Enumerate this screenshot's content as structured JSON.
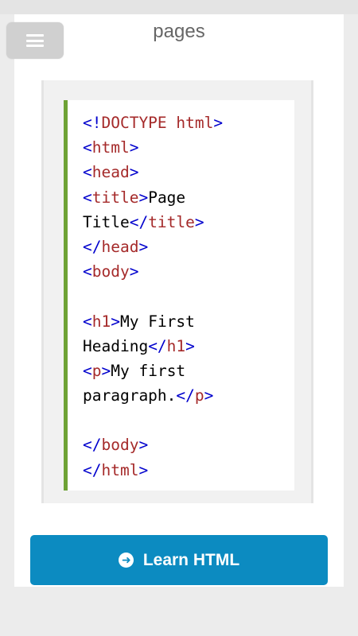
{
  "header": {
    "menu_icon": "hamburger-menu-icon",
    "title": "pages"
  },
  "colors": {
    "accent_border": "#6ea235",
    "button_bg": "#0c8bc1",
    "tag_bracket": "#0000cd",
    "tag_name": "#a52a2a"
  },
  "code_example": {
    "lines": [
      [
        {
          "t": "<!",
          "c": "b"
        },
        {
          "t": "DOCTYPE html",
          "c": "n"
        },
        {
          "t": ">",
          "c": "b"
        }
      ],
      [
        {
          "t": "<",
          "c": "b"
        },
        {
          "t": "html",
          "c": "n"
        },
        {
          "t": ">",
          "c": "b"
        }
      ],
      [
        {
          "t": "<",
          "c": "b"
        },
        {
          "t": "head",
          "c": "n"
        },
        {
          "t": ">",
          "c": "b"
        }
      ],
      [
        {
          "t": "<",
          "c": "b"
        },
        {
          "t": "title",
          "c": "n"
        },
        {
          "t": ">",
          "c": "b"
        },
        {
          "t": "Page",
          "c": "x"
        }
      ],
      [
        {
          "t": "Title",
          "c": "x"
        },
        {
          "t": "</",
          "c": "b"
        },
        {
          "t": "title",
          "c": "n"
        },
        {
          "t": ">",
          "c": "b"
        }
      ],
      [
        {
          "t": "</",
          "c": "b"
        },
        {
          "t": "head",
          "c": "n"
        },
        {
          "t": ">",
          "c": "b"
        }
      ],
      [
        {
          "t": "<",
          "c": "b"
        },
        {
          "t": "body",
          "c": "n"
        },
        {
          "t": ">",
          "c": "b"
        }
      ],
      [],
      [
        {
          "t": "<",
          "c": "b"
        },
        {
          "t": "h1",
          "c": "n"
        },
        {
          "t": ">",
          "c": "b"
        },
        {
          "t": "My First",
          "c": "x"
        }
      ],
      [
        {
          "t": "Heading",
          "c": "x"
        },
        {
          "t": "</",
          "c": "b"
        },
        {
          "t": "h1",
          "c": "n"
        },
        {
          "t": ">",
          "c": "b"
        }
      ],
      [
        {
          "t": "<",
          "c": "b"
        },
        {
          "t": "p",
          "c": "n"
        },
        {
          "t": ">",
          "c": "b"
        },
        {
          "t": "My first",
          "c": "x"
        }
      ],
      [
        {
          "t": "paragraph.",
          "c": "x"
        },
        {
          "t": "</",
          "c": "b"
        },
        {
          "t": "p",
          "c": "n"
        },
        {
          "t": ">",
          "c": "b"
        }
      ],
      [],
      [
        {
          "t": "</",
          "c": "b"
        },
        {
          "t": "body",
          "c": "n"
        },
        {
          "t": ">",
          "c": "b"
        }
      ],
      [
        {
          "t": "</",
          "c": "b"
        },
        {
          "t": "html",
          "c": "n"
        },
        {
          "t": ">",
          "c": "b"
        }
      ]
    ]
  },
  "learn_button": {
    "icon": "circle-arrow-right-icon",
    "label": "Learn HTML"
  }
}
